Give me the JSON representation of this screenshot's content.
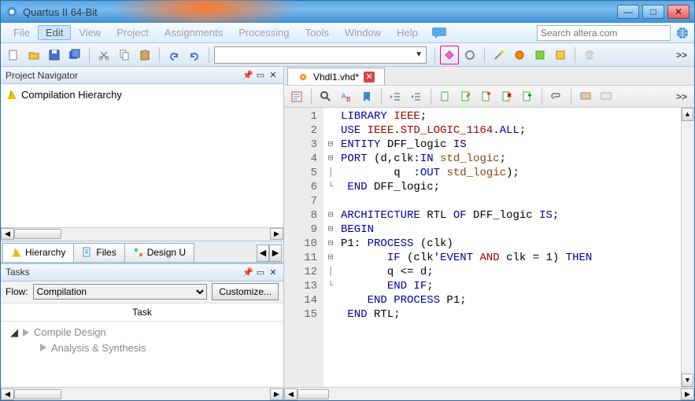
{
  "window": {
    "title": "Quartus II 64-Bit"
  },
  "menu": {
    "items": [
      "File",
      "Edit",
      "View",
      "Project",
      "Assignments",
      "Processing",
      "Tools",
      "Window",
      "Help"
    ],
    "active_index": 1,
    "search_placeholder": "Search altera.com"
  },
  "toolbar": {
    "overflow": ">>"
  },
  "project_navigator": {
    "title": "Project Navigator",
    "root": "Compilation Hierarchy",
    "tabs": [
      "Hierarchy",
      "Files",
      "Design U"
    ]
  },
  "tasks": {
    "title": "Tasks",
    "flow_label": "Flow:",
    "flow_value": "Compilation",
    "customize": "Customize...",
    "task_header": "Task",
    "rows": [
      "Compile Design",
      "Analysis & Synthesis"
    ]
  },
  "editor": {
    "file": "Vhdl1.vhd*",
    "overflow": ">>",
    "lines": [
      [
        {
          "c": "kw-blue",
          "t": "LIBRARY "
        },
        {
          "c": "kw-red",
          "t": "IEEE"
        },
        {
          "c": "kw-black",
          "t": ";"
        }
      ],
      [
        {
          "c": "kw-blue",
          "t": "USE "
        },
        {
          "c": "kw-red",
          "t": "IEEE"
        },
        {
          "c": "kw-black",
          "t": "."
        },
        {
          "c": "kw-red",
          "t": "STD_LOGIC_1164"
        },
        {
          "c": "kw-black",
          "t": "."
        },
        {
          "c": "kw-blue",
          "t": "ALL"
        },
        {
          "c": "kw-black",
          "t": ";"
        }
      ],
      [
        {
          "c": "kw-blue",
          "t": "ENTITY"
        },
        {
          "c": "kw-black",
          "t": " DFF_logic "
        },
        {
          "c": "kw-blue",
          "t": "IS"
        }
      ],
      [
        {
          "c": "kw-blue",
          "t": "PORT "
        },
        {
          "c": "kw-black",
          "t": "(d,clk:"
        },
        {
          "c": "kw-blue",
          "t": "IN "
        },
        {
          "c": "kw-brown",
          "t": "std_logic"
        },
        {
          "c": "kw-black",
          "t": ";"
        }
      ],
      [
        {
          "c": "kw-black",
          "t": "        q  :"
        },
        {
          "c": "kw-blue",
          "t": "OUT "
        },
        {
          "c": "kw-brown",
          "t": "std_logic"
        },
        {
          "c": "kw-black",
          "t": ");"
        }
      ],
      [
        {
          "c": "kw-blue",
          "t": " END"
        },
        {
          "c": "kw-black",
          "t": " DFF_logic;"
        }
      ],
      [
        {
          "c": "kw-black",
          "t": ""
        }
      ],
      [
        {
          "c": "kw-blue",
          "t": "ARCHITECTURE"
        },
        {
          "c": "kw-black",
          "t": " RTL "
        },
        {
          "c": "kw-blue",
          "t": "OF"
        },
        {
          "c": "kw-black",
          "t": " DFF_logic "
        },
        {
          "c": "kw-blue",
          "t": "IS"
        },
        {
          "c": "kw-black",
          "t": ";"
        }
      ],
      [
        {
          "c": "kw-blue",
          "t": "BEGIN"
        }
      ],
      [
        {
          "c": "kw-black",
          "t": "P1: "
        },
        {
          "c": "kw-blue",
          "t": "PROCESS"
        },
        {
          "c": "kw-black",
          "t": " (clk)"
        }
      ],
      [
        {
          "c": "kw-black",
          "t": "       "
        },
        {
          "c": "kw-blue",
          "t": "IF"
        },
        {
          "c": "kw-black",
          "t": " (clk'"
        },
        {
          "c": "kw-blue",
          "t": "EVENT "
        },
        {
          "c": "kw-red",
          "t": "AND"
        },
        {
          "c": "kw-black",
          "t": " clk = 1) "
        },
        {
          "c": "kw-blue",
          "t": "THEN"
        }
      ],
      [
        {
          "c": "kw-black",
          "t": "       q <= d;"
        }
      ],
      [
        {
          "c": "kw-black",
          "t": "       "
        },
        {
          "c": "kw-blue",
          "t": "END IF"
        },
        {
          "c": "kw-black",
          "t": ";"
        }
      ],
      [
        {
          "c": "kw-black",
          "t": "    "
        },
        {
          "c": "kw-blue",
          "t": "END PROCESS"
        },
        {
          "c": "kw-black",
          "t": " P1;"
        }
      ],
      [
        {
          "c": "kw-black",
          "t": " "
        },
        {
          "c": "kw-blue",
          "t": "END"
        },
        {
          "c": "kw-black",
          "t": " RTL;"
        }
      ]
    ],
    "fold": [
      "",
      "",
      "⊟",
      "⊟",
      "│",
      "└",
      "",
      "⊟",
      "⊟",
      "⊟",
      "⊟",
      "│",
      "└",
      "",
      "",
      ""
    ]
  }
}
